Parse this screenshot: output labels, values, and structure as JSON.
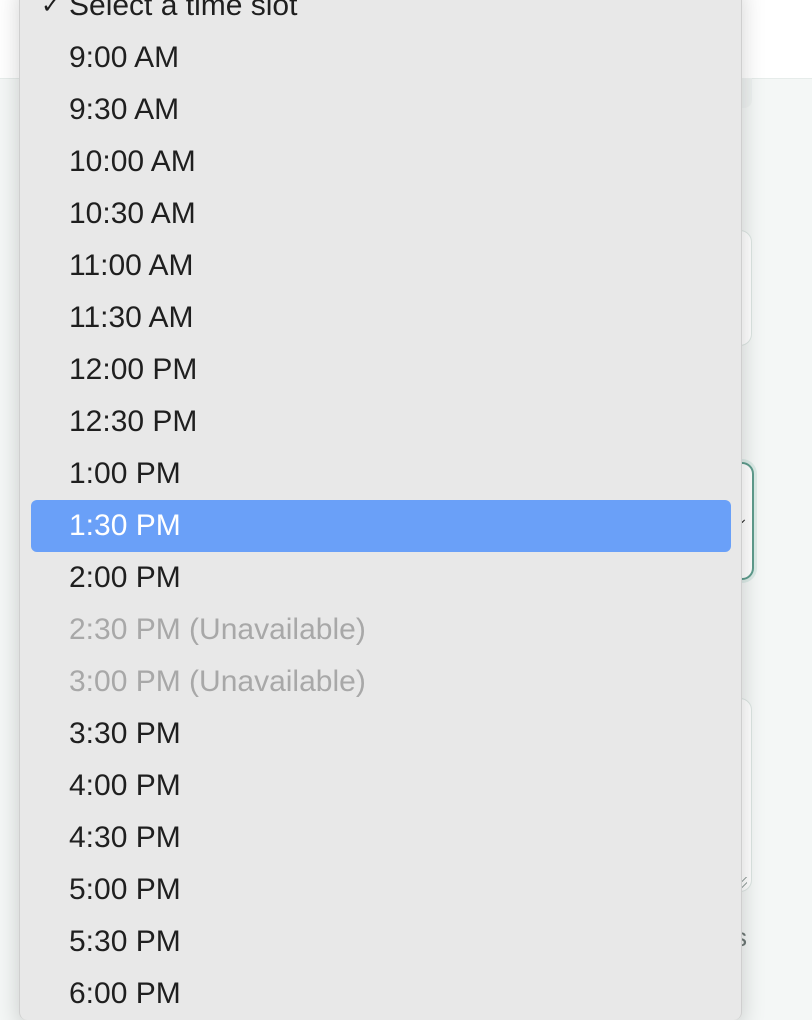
{
  "background": {
    "hint_text": "s"
  },
  "dropdown": {
    "selected_label": "Select a time slot",
    "highlighted_index": 9,
    "options": [
      {
        "label": "Select a time slot",
        "checked": true,
        "disabled": false
      },
      {
        "label": "9:00 AM",
        "checked": false,
        "disabled": false
      },
      {
        "label": "9:30 AM",
        "checked": false,
        "disabled": false
      },
      {
        "label": "10:00 AM",
        "checked": false,
        "disabled": false
      },
      {
        "label": "10:30 AM",
        "checked": false,
        "disabled": false
      },
      {
        "label": "11:00 AM",
        "checked": false,
        "disabled": false
      },
      {
        "label": "11:30 AM",
        "checked": false,
        "disabled": false
      },
      {
        "label": "12:00 PM",
        "checked": false,
        "disabled": false
      },
      {
        "label": "12:30 PM",
        "checked": false,
        "disabled": false
      },
      {
        "label": "1:00 PM",
        "checked": false,
        "disabled": false
      },
      {
        "label": "1:30 PM",
        "checked": false,
        "disabled": false
      },
      {
        "label": "2:00 PM",
        "checked": false,
        "disabled": false
      },
      {
        "label": "2:30 PM (Unavailable)",
        "checked": false,
        "disabled": true
      },
      {
        "label": "3:00 PM (Unavailable)",
        "checked": false,
        "disabled": true
      },
      {
        "label": "3:30 PM",
        "checked": false,
        "disabled": false
      },
      {
        "label": "4:00 PM",
        "checked": false,
        "disabled": false
      },
      {
        "label": "4:30 PM",
        "checked": false,
        "disabled": false
      },
      {
        "label": "5:00 PM",
        "checked": false,
        "disabled": false
      },
      {
        "label": "5:30 PM",
        "checked": false,
        "disabled": false
      },
      {
        "label": "6:00 PM",
        "checked": false,
        "disabled": false
      }
    ],
    "check_glyph": "✓",
    "colors": {
      "menu_background": "#e8e8e8",
      "highlight": "#6aa0f8",
      "disabled_text": "#a8a8a8"
    }
  }
}
